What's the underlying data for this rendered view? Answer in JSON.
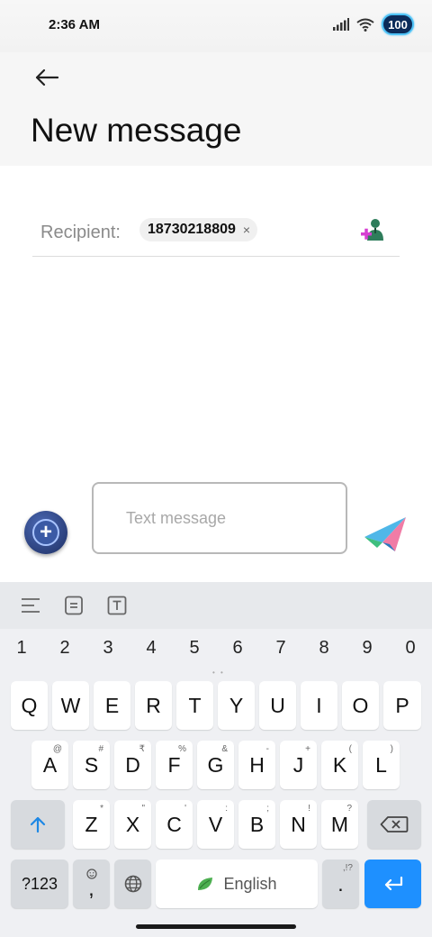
{
  "status": {
    "time": "2:36 AM",
    "battery": "100"
  },
  "header": {
    "title": "New message"
  },
  "recipient": {
    "label": "Recipient:",
    "chip_value": "18730218809",
    "chip_close": "×"
  },
  "composer": {
    "placeholder": "Text message"
  },
  "keyboard": {
    "number_row": [
      "1",
      "2",
      "3",
      "4",
      "5",
      "6",
      "7",
      "8",
      "9",
      "0"
    ],
    "row1": [
      {
        "key": "Q",
        "sup": ""
      },
      {
        "key": "W",
        "sup": ""
      },
      {
        "key": "E",
        "sup": ""
      },
      {
        "key": "R",
        "sup": ""
      },
      {
        "key": "T",
        "sup": ""
      },
      {
        "key": "Y",
        "sup": ""
      },
      {
        "key": "U",
        "sup": ""
      },
      {
        "key": "I",
        "sup": ""
      },
      {
        "key": "O",
        "sup": ""
      },
      {
        "key": "P",
        "sup": ""
      }
    ],
    "row2": [
      {
        "key": "A",
        "sup": "@"
      },
      {
        "key": "S",
        "sup": "#"
      },
      {
        "key": "D",
        "sup": "₹"
      },
      {
        "key": "F",
        "sup": "%"
      },
      {
        "key": "G",
        "sup": "&"
      },
      {
        "key": "H",
        "sup": "-"
      },
      {
        "key": "J",
        "sup": "+"
      },
      {
        "key": "K",
        "sup": "("
      },
      {
        "key": "L",
        "sup": ")"
      }
    ],
    "row3": [
      {
        "key": "Z",
        "sup": "*"
      },
      {
        "key": "X",
        "sup": "\""
      },
      {
        "key": "C",
        "sup": "'"
      },
      {
        "key": "V",
        "sup": ":"
      },
      {
        "key": "B",
        "sup": ";"
      },
      {
        "key": "N",
        "sup": "!"
      },
      {
        "key": "M",
        "sup": "?"
      }
    ],
    "symbols_label": "?123",
    "comma": ",",
    "space_label": "English",
    "period": ".",
    "period_sup": ",!?"
  }
}
